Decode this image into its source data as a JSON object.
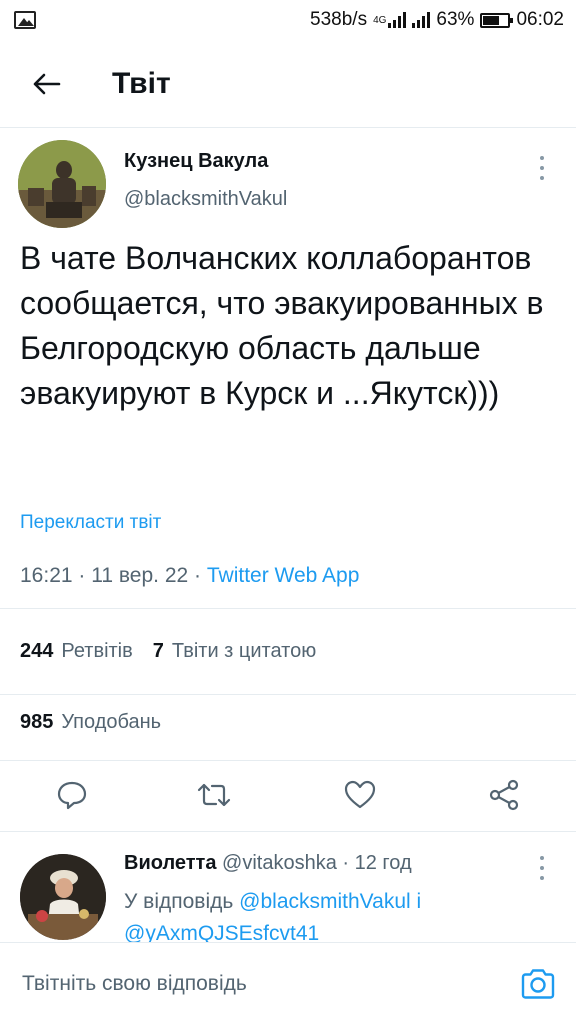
{
  "status_bar": {
    "speed": "538b/s",
    "network": "4G",
    "battery_percent": "63%",
    "battery_level": 0.63,
    "time": "06:02"
  },
  "header": {
    "title": "Твіт"
  },
  "tweet": {
    "author_name": "Кузнец Вакула",
    "author_handle": "@blacksmithVakul",
    "text": "В чате Волчанских коллаборантов сообщается, что эвакуированных в Белгородскую область дальше эвакуируют в Курск и ...Якутск)))",
    "translate_label": "Перекласти твіт",
    "time": "16:21",
    "date": "11 вер. 22",
    "source": "Twitter Web App",
    "retweets_count": "244",
    "retweets_label": "Ретвітів",
    "quotes_count": "7",
    "quotes_label": "Твіти з цитатою",
    "likes_count": "985",
    "likes_label": "Уподобань"
  },
  "reply": {
    "author_name": "Виолетта",
    "author_handle": "@vitakoshka",
    "age": "12 год",
    "replying_to_label": "У відповідь",
    "mention_1": "@blacksmithVakul",
    "and_label": "і",
    "mention_2": "@yAxmQJSEsfcvt41"
  },
  "compose": {
    "placeholder": "Твітніть свою відповідь"
  },
  "colors": {
    "accent": "#1d9bf0",
    "secondary_text": "#536471",
    "divider": "#e6ecf0"
  },
  "icons": [
    "gallery-icon",
    "back-arrow-icon",
    "more-vertical-icon",
    "reply-icon",
    "retweet-icon",
    "like-icon",
    "share-icon",
    "camera-icon"
  ]
}
